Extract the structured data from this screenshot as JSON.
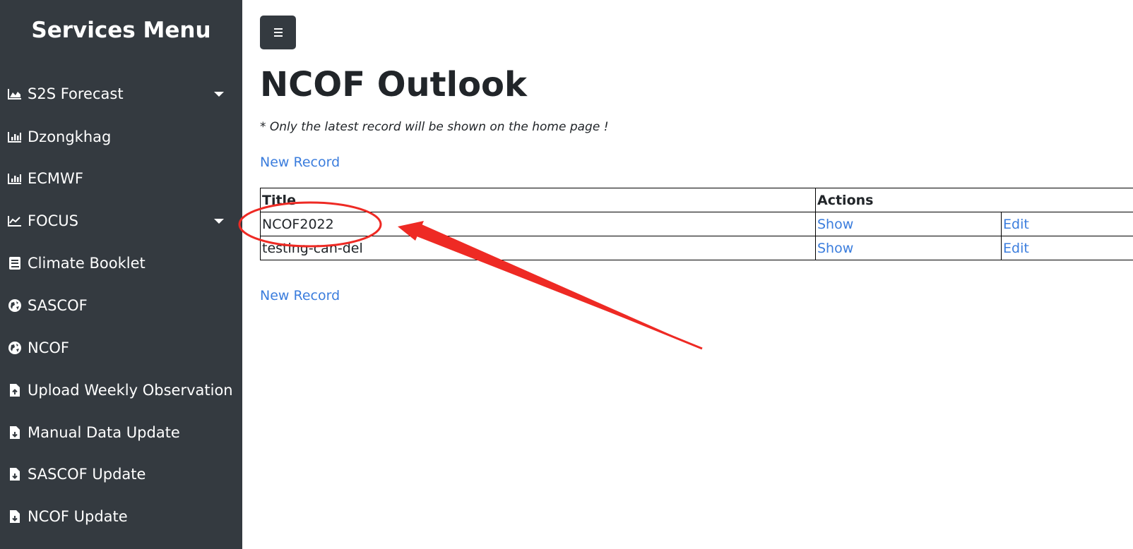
{
  "sidebar": {
    "title": "Services Menu",
    "items": [
      {
        "label": "S2S Forecast",
        "icon": "area-chart-icon",
        "dropdown": true
      },
      {
        "label": "Dzongkhag",
        "icon": "bar-chart-icon",
        "dropdown": false
      },
      {
        "label": "ECMWF",
        "icon": "bar-chart-icon",
        "dropdown": false
      },
      {
        "label": "FOCUS",
        "icon": "line-chart-icon",
        "dropdown": true
      },
      {
        "label": "Climate Booklet",
        "icon": "book-icon",
        "dropdown": false
      },
      {
        "label": "SASCOF",
        "icon": "globe-icon",
        "dropdown": false
      },
      {
        "label": "NCOF",
        "icon": "globe-icon",
        "dropdown": false
      },
      {
        "label": "Upload Weekly Observation",
        "icon": "file-upload-icon",
        "dropdown": false
      },
      {
        "label": "Manual Data Update",
        "icon": "file-download-icon",
        "dropdown": false
      },
      {
        "label": "SASCOF Update",
        "icon": "file-download-icon",
        "dropdown": false
      },
      {
        "label": "NCOF Update",
        "icon": "file-download-icon",
        "dropdown": false
      }
    ]
  },
  "main": {
    "menu_button_icon": "hamburger-icon",
    "title": "NCOF Outlook",
    "note": "* Only the latest record will be shown on the home page !",
    "new_record_top": "New Record",
    "new_record_bottom": "New Record",
    "table": {
      "headers": [
        "Title",
        "Actions"
      ],
      "rows": [
        {
          "title": "NCOF2022",
          "show": "Show",
          "edit": "Edit"
        },
        {
          "title": "testing-can-del",
          "show": "Show",
          "edit": "Edit"
        }
      ]
    }
  },
  "colors": {
    "sidebar_bg": "#343a40",
    "link": "#3b7ddd",
    "annotation": "#ee2a24"
  }
}
